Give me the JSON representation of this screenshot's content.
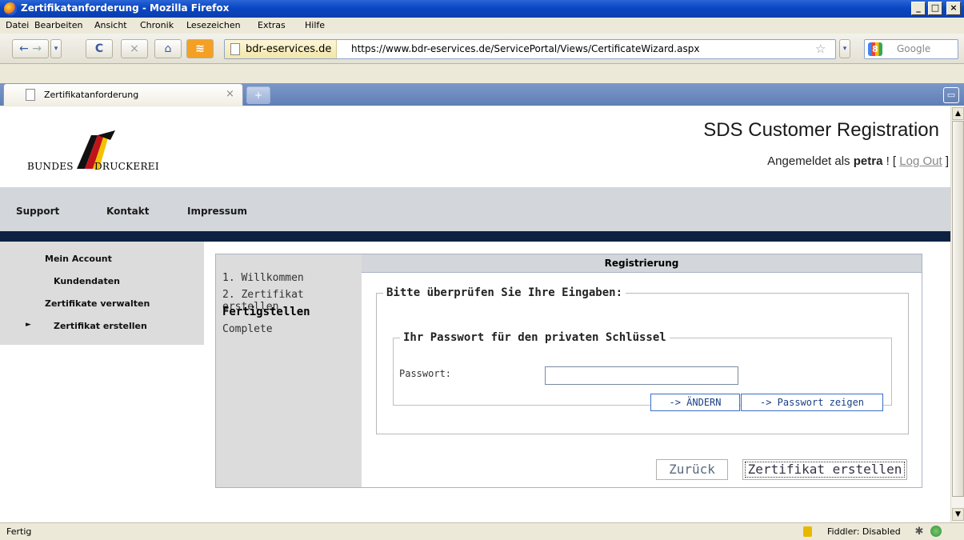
{
  "window": {
    "title": "Zertifikatanforderung - Mozilla Firefox"
  },
  "menu": [
    "Datei",
    "Bearbeiten",
    "Ansicht",
    "Chronik",
    "Lesezeichen",
    "Extras",
    "Hilfe"
  ],
  "toolbar": {
    "site_identity": "bdr-eservices.de",
    "url": "https://www.bdr-eservices.de/ServicePortal/Views/CertificateWizard.aspx",
    "search_placeholder": "Google"
  },
  "tabs": [
    {
      "label": "Zertifikatanforderung"
    }
  ],
  "header": {
    "logo_left": "BUNDES",
    "logo_right": "DRUCKEREI",
    "app_title": "SDS Customer Registration",
    "login_prefix": "Angemeldet als",
    "username": "petra",
    "login_mid": "! [",
    "logout": "Log Out",
    "login_suffix": "]"
  },
  "main_nav": [
    "Support",
    "Kontakt",
    "Impressum"
  ],
  "side_nav": {
    "items": [
      "Mein Account",
      "Kundendaten",
      "Zertifikate verwalten",
      "Zertifikat erstellen"
    ],
    "active_marker": "►"
  },
  "wizard": {
    "steps": [
      "1. Willkommen",
      "2. Zertifikat erstellen",
      "Fertigstellen",
      "Complete"
    ],
    "current_step": "Fertigstellen",
    "header": "Registrierung",
    "legend_outer": "Bitte überprüfen Sie Ihre Eingaben:",
    "legend_inner": "Ihr Passwort für den privaten Schlüssel",
    "password_label": "Passwort:",
    "password_value": "",
    "btn_change": "-> ÄNDERN",
    "btn_show_pw": "-> Passwort zeigen",
    "btn_back": "Zurück",
    "btn_create": "Zertifikat erstellen"
  },
  "status": {
    "message": "Fertig",
    "fiddler": "Fiddler: Disabled"
  },
  "colors": {
    "nav_rule": "#0d2242",
    "nav_bg": "#d3d6da",
    "side_bg": "#dcdcdc",
    "button_blue": "#3a6fc7"
  }
}
